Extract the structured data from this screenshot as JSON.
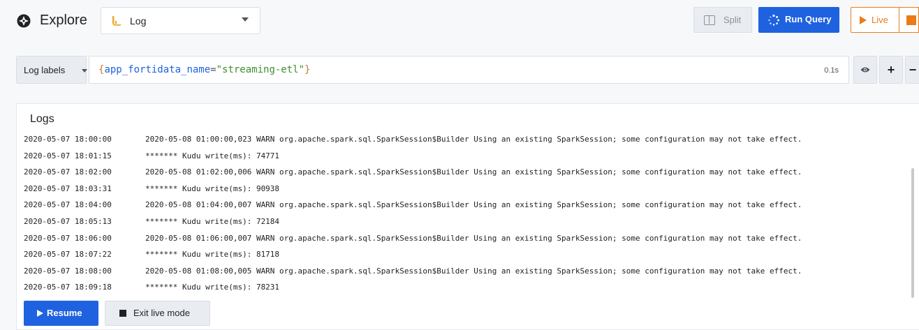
{
  "header": {
    "title": "Explore",
    "datasource": "Log",
    "split_label": "Split",
    "run_label": "Run Query",
    "live_label": "Live"
  },
  "query": {
    "label_button": "Log labels",
    "open_brace": "{",
    "key": "app_fortidata_name",
    "operator": "=",
    "value": "\"streaming-etl\"",
    "close_brace": "}",
    "time": "0.1s",
    "add_label": "+",
    "remove_label": "−"
  },
  "logs": {
    "title": "Logs",
    "rows": [
      {
        "ts": "2020-05-07 18:00:00",
        "msg": "2020-05-08 01:00:00,023 WARN org.apache.spark.sql.SparkSession$Builder Using an existing SparkSession; some configuration may not take effect."
      },
      {
        "ts": "2020-05-07 18:01:15",
        "msg": "******* Kudu write(ms): 74771"
      },
      {
        "ts": "2020-05-07 18:02:00",
        "msg": "2020-05-08 01:02:00,006 WARN org.apache.spark.sql.SparkSession$Builder Using an existing SparkSession; some configuration may not take effect."
      },
      {
        "ts": "2020-05-07 18:03:31",
        "msg": "******* Kudu write(ms): 90938"
      },
      {
        "ts": "2020-05-07 18:04:00",
        "msg": "2020-05-08 01:04:00,007 WARN org.apache.spark.sql.SparkSession$Builder Using an existing SparkSession; some configuration may not take effect."
      },
      {
        "ts": "2020-05-07 18:05:13",
        "msg": "******* Kudu write(ms): 72184"
      },
      {
        "ts": "2020-05-07 18:06:00",
        "msg": "2020-05-08 01:06:00,007 WARN org.apache.spark.sql.SparkSession$Builder Using an existing SparkSession; some configuration may not take effect."
      },
      {
        "ts": "2020-05-07 18:07:22",
        "msg": "******* Kudu write(ms): 81718"
      },
      {
        "ts": "2020-05-07 18:08:00",
        "msg": "2020-05-08 01:08:00,005 WARN org.apache.spark.sql.SparkSession$Builder Using an existing SparkSession; some configuration may not take effect."
      },
      {
        "ts": "2020-05-07 18:09:18",
        "msg": "******* Kudu write(ms): 78231"
      }
    ],
    "resume_label": "Resume",
    "exit_label": "Exit live mode"
  },
  "colors": {
    "primary": "#1f62e0",
    "live": "#eb7b18",
    "string": "#3f8f30"
  },
  "icons": [
    "compass-icon",
    "logs-datasource-icon",
    "split-icon",
    "run-query-icon",
    "play-icon",
    "stop-icon",
    "eye-icon"
  ]
}
